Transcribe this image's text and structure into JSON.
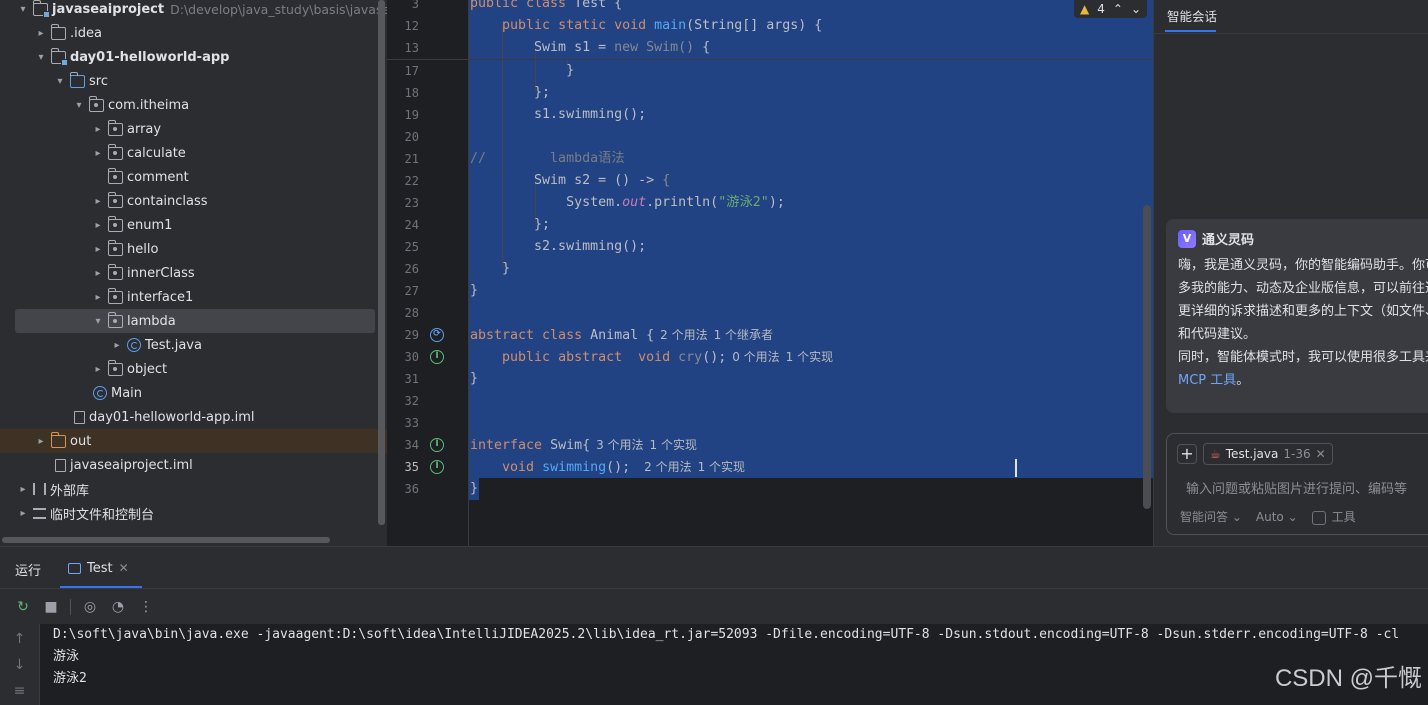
{
  "project_tree": {
    "root_name": "javaseaiproject",
    "root_path": "D:\\develop\\java_study\\basis\\javaseaiproject",
    "items": [
      {
        "label": "javaseaiproject",
        "path": "D:\\develop\\java_study\\basis\\javaseaiproject"
      },
      {
        "label": ".idea"
      },
      {
        "label": "day01-helloworld-app"
      },
      {
        "label": "src"
      },
      {
        "label": "com.itheima"
      },
      {
        "label": "array"
      },
      {
        "label": "calculate"
      },
      {
        "label": "comment"
      },
      {
        "label": "containclass"
      },
      {
        "label": "enum1"
      },
      {
        "label": "hello"
      },
      {
        "label": "innerClass"
      },
      {
        "label": "interface1"
      },
      {
        "label": "lambda"
      },
      {
        "label": "Test.java"
      },
      {
        "label": "object"
      },
      {
        "label": "Main"
      },
      {
        "label": "day01-helloworld-app.iml"
      },
      {
        "label": "out"
      },
      {
        "label": "javaseaiproject.iml"
      },
      {
        "label": "外部库"
      },
      {
        "label": "临时文件和控制台"
      }
    ]
  },
  "editor": {
    "warning_count": "4",
    "lines": [
      {
        "no": "3",
        "code": "public class Test {"
      },
      {
        "no": "12",
        "code": "    public static void main(String[] args) {"
      },
      {
        "no": "13",
        "code": "        Swim s1 = new Swim() {"
      },
      {
        "no": "17",
        "code": "            }"
      },
      {
        "no": "18",
        "code": "        };"
      },
      {
        "no": "19",
        "code": "        s1.swimming();"
      },
      {
        "no": "20",
        "code": ""
      },
      {
        "no": "21",
        "code": "//        lambda语法"
      },
      {
        "no": "22",
        "code": "        Swim s2 = () -> {"
      },
      {
        "no": "23",
        "code": "            System.out.println(\"游泳2\");"
      },
      {
        "no": "24",
        "code": "        };"
      },
      {
        "no": "25",
        "code": "        s2.swimming();"
      },
      {
        "no": "26",
        "code": "    }"
      },
      {
        "no": "27",
        "code": "}"
      },
      {
        "no": "28",
        "code": ""
      },
      {
        "no": "29",
        "code": "abstract class Animal {"
      },
      {
        "no": "30",
        "code": "    public abstract  void cry();"
      },
      {
        "no": "31",
        "code": "}"
      },
      {
        "no": "32",
        "code": ""
      },
      {
        "no": "33",
        "code": ""
      },
      {
        "no": "34",
        "code": "interface Swim{"
      },
      {
        "no": "35",
        "code": "    void swimming();"
      },
      {
        "no": "36",
        "code": "}"
      }
    ],
    "hints": {
      "animal": [
        "2 个用法",
        "1 个继承者"
      ],
      "cry": [
        "0 个用法",
        "1 个实现"
      ],
      "swim": [
        "3 个用法",
        "1 个实现"
      ],
      "swimming": [
        "2 个用法",
        "1 个实现"
      ]
    }
  },
  "ai_panel": {
    "tab": "智能会话",
    "title": "通义灵码",
    "logo_glyph": "V",
    "message_lines": [
      "嗨，我是通义灵码，你的智能编码助手。你可",
      "多我的能力、动态及企业版信息，可以前往通",
      "更详细的诉求描述和更多的上下文（如文件、",
      "和代码建议。",
      "同时，智能体模式时，我可以使用很多工具来"
    ],
    "mcp_link": "MCP 工具",
    "mcp_suffix": "。",
    "context_chip": {
      "file": "Test.java",
      "range": "1-36"
    },
    "input_placeholder": "输入问题或粘贴图片进行提问、编码等",
    "mode": "智能问答",
    "model": "Auto",
    "tools_label": "工具"
  },
  "run_panel": {
    "label": "运行",
    "tab": "Test",
    "output": [
      "D:\\soft\\java\\bin\\java.exe -javaagent:D:\\soft\\idea\\IntelliJIDEA2025.2\\lib\\idea_rt.jar=52093 -Dfile.encoding=UTF-8 -Dsun.stdout.encoding=UTF-8 -Dsun.stderr.encoding=UTF-8 -cl",
      "游泳",
      "游泳2"
    ]
  },
  "watermark": "CSDN @千慨",
  "colors": {
    "selection": "#214283",
    "keyword": "#cf8e6d",
    "function": "#56a8f5",
    "string": "#6aab73",
    "accent": "#3574f0"
  }
}
